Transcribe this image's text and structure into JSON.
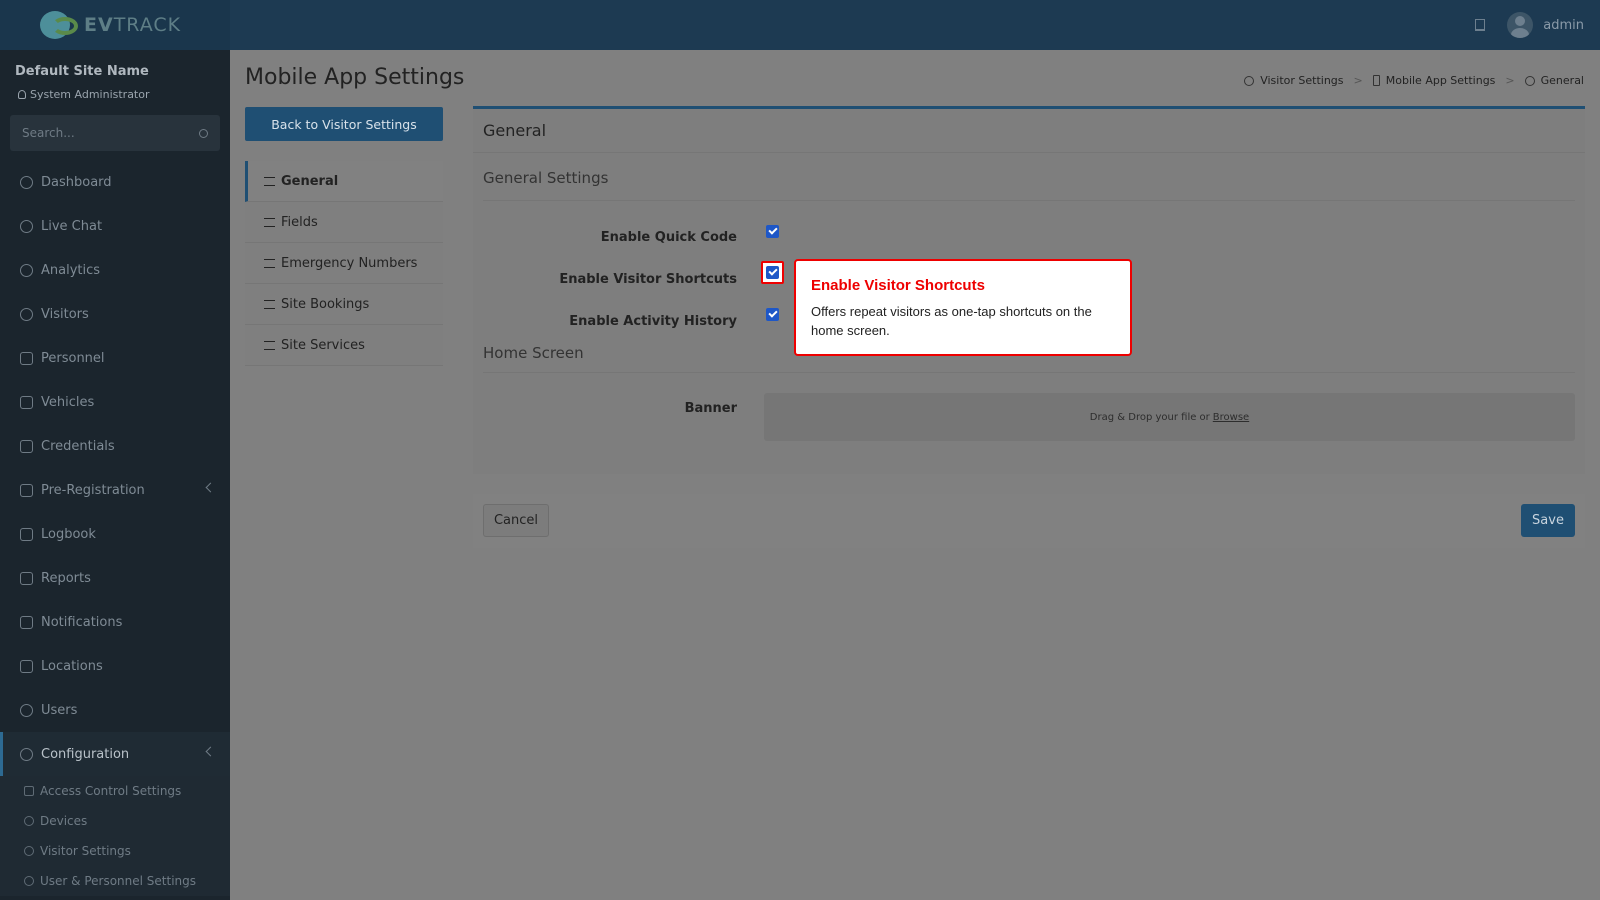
{
  "app": {
    "logo_text_bold": "EV",
    "logo_text": "TRACK",
    "user": "admin"
  },
  "sidebar": {
    "site_name": "Default Site Name",
    "role": "System Administrator",
    "search_placeholder": "Search...",
    "items": [
      {
        "label": "Dashboard",
        "icon": "dashboard-icon"
      },
      {
        "label": "Live Chat",
        "icon": "headset-icon"
      },
      {
        "label": "Analytics",
        "icon": "analytics-icon"
      },
      {
        "label": "Visitors",
        "icon": "eye-icon"
      },
      {
        "label": "Personnel",
        "icon": "personnel-icon"
      },
      {
        "label": "Vehicles",
        "icon": "vehicle-icon"
      },
      {
        "label": "Credentials",
        "icon": "credentials-icon"
      },
      {
        "label": "Pre-Registration",
        "icon": "arrows-icon"
      },
      {
        "label": "Logbook",
        "icon": "logbook-icon"
      },
      {
        "label": "Reports",
        "icon": "reports-icon"
      },
      {
        "label": "Notifications",
        "icon": "notifications-icon"
      },
      {
        "label": "Locations",
        "icon": "locations-icon"
      },
      {
        "label": "Users",
        "icon": "users-icon"
      },
      {
        "label": "Configuration",
        "icon": "gear-icon"
      }
    ],
    "sub_items": [
      {
        "label": "Access Control Settings",
        "icon": "lock-icon"
      },
      {
        "label": "Devices",
        "icon": "devices-icon"
      },
      {
        "label": "Visitor Settings",
        "icon": "eye-icon"
      },
      {
        "label": "User & Personnel Settings",
        "icon": "users-icon"
      }
    ]
  },
  "page": {
    "title": "Mobile App Settings",
    "breadcrumb": [
      "Visitor Settings",
      "Mobile App Settings",
      "General"
    ],
    "back_button": "Back to Visitor Settings"
  },
  "tabs": [
    {
      "label": "General",
      "icon": "sliders-icon"
    },
    {
      "label": "Fields",
      "icon": "checklist-icon"
    },
    {
      "label": "Emergency Numbers",
      "icon": "phone-icon"
    },
    {
      "label": "Site Bookings",
      "icon": "calendar-icon"
    },
    {
      "label": "Site Services",
      "icon": "bell-icon"
    }
  ],
  "panel": {
    "title": "General",
    "general_section": "General Settings",
    "fields": [
      {
        "label": "Enable Quick Code",
        "checked": true
      },
      {
        "label": "Enable Visitor Shortcuts",
        "checked": true
      },
      {
        "label": "Enable Activity History",
        "checked": true
      }
    ],
    "home_section": "Home Screen",
    "banner_label": "Banner",
    "dropzone_text": "Drag & Drop your file or",
    "dropzone_link": "Browse"
  },
  "footer": {
    "cancel": "Cancel",
    "save": "Save"
  },
  "tooltip": {
    "title": "Enable Visitor Shortcuts",
    "body": "Offers repeat visitors as one-tap shortcuts on the home screen."
  },
  "colors": {
    "accent": "#1f4f73",
    "highlight": "#ee0000",
    "checkbox": "#1e57c7"
  }
}
